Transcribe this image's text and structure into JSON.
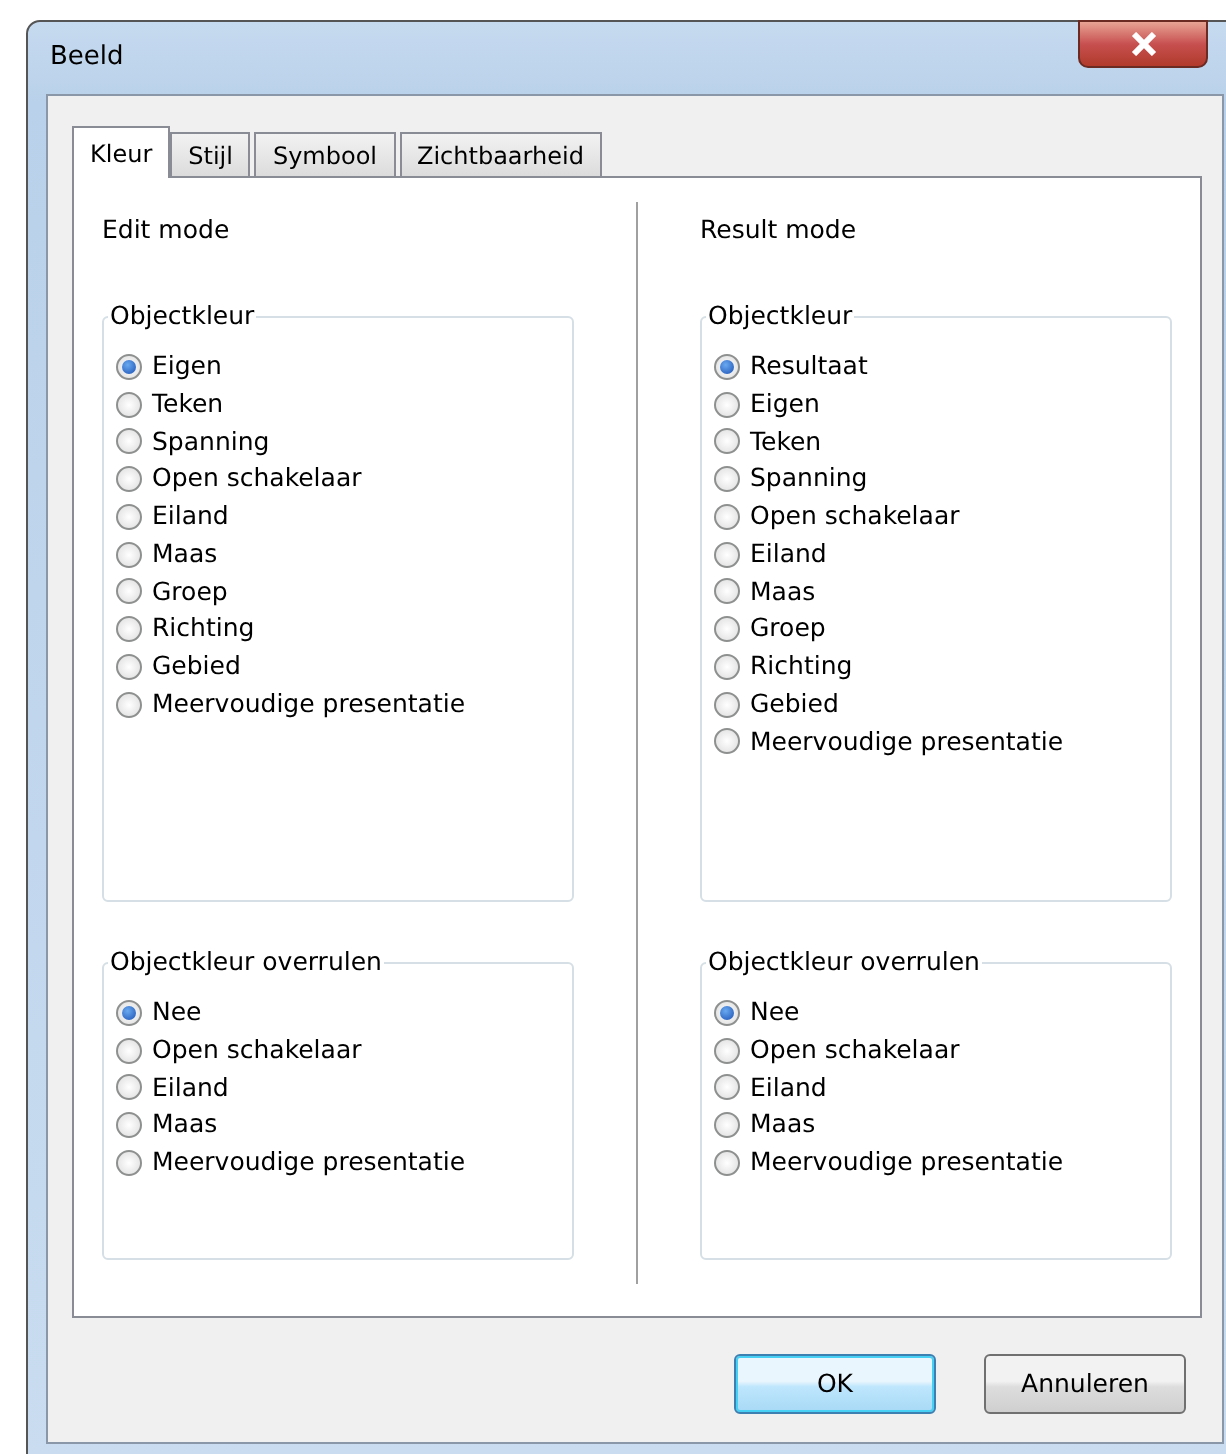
{
  "window": {
    "title": "Beeld"
  },
  "tabs": [
    {
      "label": "Kleur",
      "selected": true
    },
    {
      "label": "Stijl",
      "selected": false
    },
    {
      "label": "Symbool",
      "selected": false
    },
    {
      "label": "Zichtbaarheid",
      "selected": false
    }
  ],
  "columns": [
    {
      "heading": "Edit mode",
      "groups": [
        {
          "legend": "Objectkleur",
          "options": [
            {
              "label": "Eigen",
              "selected": true
            },
            {
              "label": "Teken",
              "selected": false
            },
            {
              "label": "Spanning",
              "selected": false
            },
            {
              "label": "Open schakelaar",
              "selected": false
            },
            {
              "label": "Eiland",
              "selected": false
            },
            {
              "label": "Maas",
              "selected": false
            },
            {
              "label": "Groep",
              "selected": false
            },
            {
              "label": "Richting",
              "selected": false
            },
            {
              "label": "Gebied",
              "selected": false
            },
            {
              "label": "Meervoudige presentatie",
              "selected": false
            }
          ]
        },
        {
          "legend": "Objectkleur overrulen",
          "options": [
            {
              "label": "Nee",
              "selected": true
            },
            {
              "label": "Open schakelaar",
              "selected": false
            },
            {
              "label": "Eiland",
              "selected": false
            },
            {
              "label": "Maas",
              "selected": false
            },
            {
              "label": "Meervoudige presentatie",
              "selected": false
            }
          ]
        }
      ]
    },
    {
      "heading": "Result mode",
      "groups": [
        {
          "legend": "Objectkleur",
          "options": [
            {
              "label": "Resultaat",
              "selected": true
            },
            {
              "label": "Eigen",
              "selected": false
            },
            {
              "label": "Teken",
              "selected": false
            },
            {
              "label": "Spanning",
              "selected": false
            },
            {
              "label": "Open schakelaar",
              "selected": false
            },
            {
              "label": "Eiland",
              "selected": false
            },
            {
              "label": "Maas",
              "selected": false
            },
            {
              "label": "Groep",
              "selected": false
            },
            {
              "label": "Richting",
              "selected": false
            },
            {
              "label": "Gebied",
              "selected": false
            },
            {
              "label": "Meervoudige presentatie",
              "selected": false
            }
          ]
        },
        {
          "legend": "Objectkleur overrulen",
          "options": [
            {
              "label": "Nee",
              "selected": true
            },
            {
              "label": "Open schakelaar",
              "selected": false
            },
            {
              "label": "Eiland",
              "selected": false
            },
            {
              "label": "Maas",
              "selected": false
            },
            {
              "label": "Meervoudige presentatie",
              "selected": false
            }
          ]
        }
      ]
    }
  ],
  "buttons": [
    {
      "label": "OK",
      "default": true
    },
    {
      "label": "Annuleren",
      "default": false
    }
  ]
}
